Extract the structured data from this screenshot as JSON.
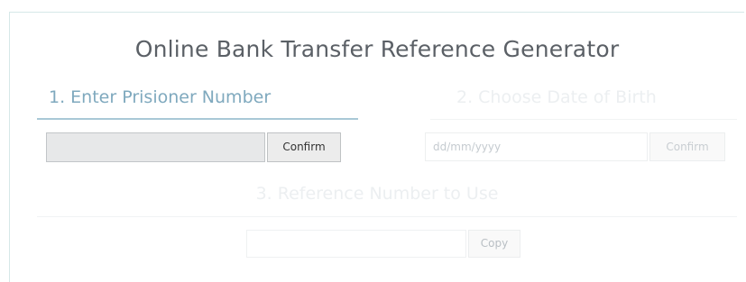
{
  "page": {
    "title": "Online Bank Transfer Reference Generator"
  },
  "step1": {
    "label": "1. Enter Prisioner Number",
    "input_value": "",
    "button_label": "Confirm"
  },
  "step2": {
    "label": "2. Choose Date of Birth",
    "input_placeholder": "dd/mm/yyyy",
    "button_label": "Confirm"
  },
  "step3": {
    "label": "3. Reference Number to Use",
    "input_value": "",
    "button_label": "Copy"
  },
  "colors": {
    "active_step": "#7fa9be",
    "inactive_step": "#eceff1",
    "title": "#5b6066"
  }
}
